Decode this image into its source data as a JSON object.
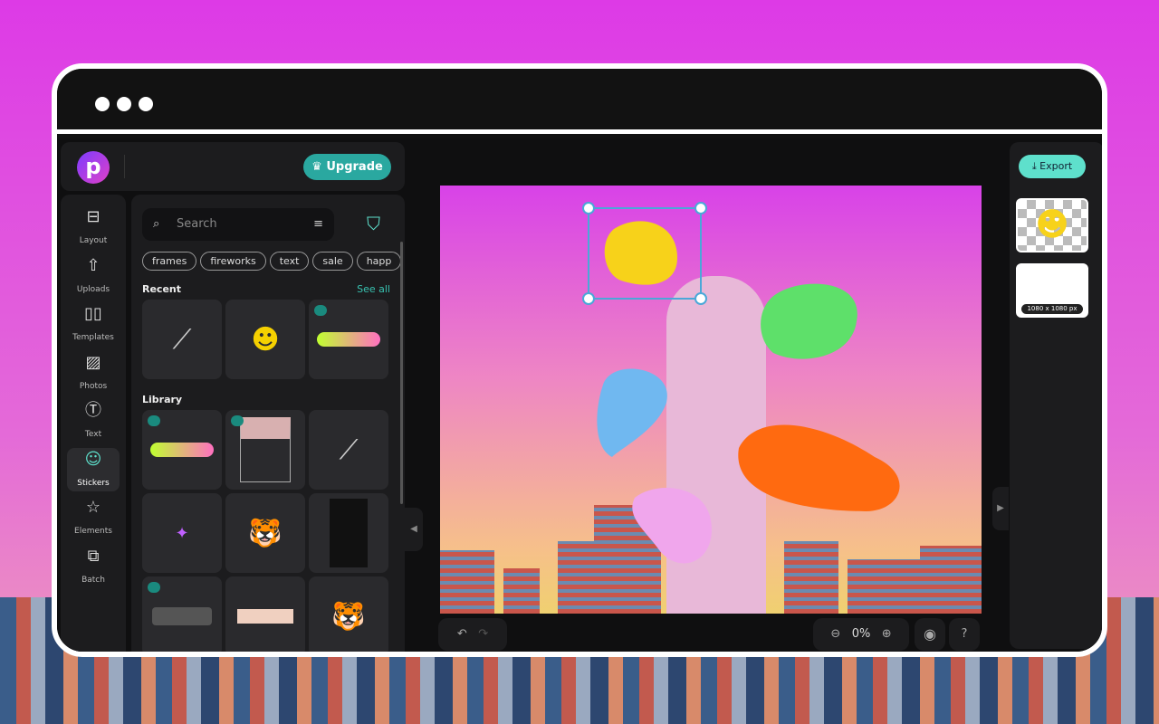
{
  "app": {
    "logo_letter": "p",
    "upgrade_label": "Upgrade",
    "export_label": "Export"
  },
  "rail": [
    {
      "label": "Layout",
      "icon": "layout-icon"
    },
    {
      "label": "Uploads",
      "icon": "upload-icon"
    },
    {
      "label": "Templates",
      "icon": "book-icon"
    },
    {
      "label": "Photos",
      "icon": "image-icon"
    },
    {
      "label": "Text",
      "icon": "text-icon"
    },
    {
      "label": "Stickers",
      "icon": "sticker-icon",
      "active": true
    },
    {
      "label": "Elements",
      "icon": "star-icon"
    },
    {
      "label": "Batch",
      "icon": "batch-icon"
    }
  ],
  "panel": {
    "search_placeholder": "Search",
    "chips": [
      "frames",
      "fireworks",
      "text",
      "sale",
      "happ"
    ],
    "recent_title": "Recent",
    "see_all": "See all",
    "library_title": "Library"
  },
  "zoom": {
    "value": "0%"
  },
  "pages": {
    "size_label": "1080 x 1080 px"
  },
  "colors": {
    "accent": "#2aa8a0",
    "export": "#5ee0cc",
    "selection": "#4aa8d8"
  }
}
